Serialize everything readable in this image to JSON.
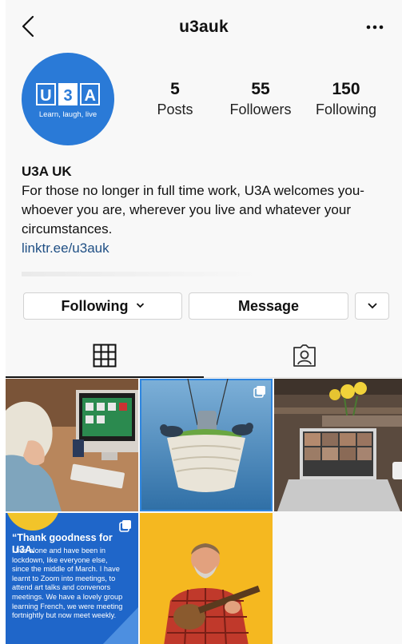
{
  "header": {
    "username": "u3auk"
  },
  "avatar": {
    "logo_letters": [
      "U",
      "3",
      "A"
    ],
    "tagline": "Learn, laugh, live"
  },
  "stats": [
    {
      "value": "5",
      "label": "Posts"
    },
    {
      "value": "55",
      "label": "Followers"
    },
    {
      "value": "150",
      "label": "Following"
    }
  ],
  "bio": {
    "name": "U3A UK",
    "text": "For those no longer in full time work, U3A welcomes you- whoever you are, wherever you live and whatever your circumstances.",
    "link": "linktr.ee/u3auk"
  },
  "actions": {
    "following_label": "Following",
    "message_label": "Message"
  },
  "posts": [
    {
      "kind": "photo",
      "subject": "woman-video-call"
    },
    {
      "kind": "photo",
      "subject": "bird-feeder",
      "multi": true
    },
    {
      "kind": "photo",
      "subject": "laptop-zoom"
    },
    {
      "kind": "quote",
      "multi": true,
      "heading": "“Thank goodness for U3A.",
      "body": "I live alone and have been in lockdown, like everyone else, since the middle of March. I have learnt to Zoom into meetings, to attend art talks and convenors meetings. We have a lovely group learning French, we were meeting fortnightly but now meet weekly."
    },
    {
      "kind": "photo",
      "subject": "man-ukulele"
    }
  ],
  "colors": {
    "brand_blue": "#2a7ad7",
    "link": "#1f4f84",
    "quote_bg": "#1f66c9",
    "yellow_bg": "#f5b820"
  }
}
